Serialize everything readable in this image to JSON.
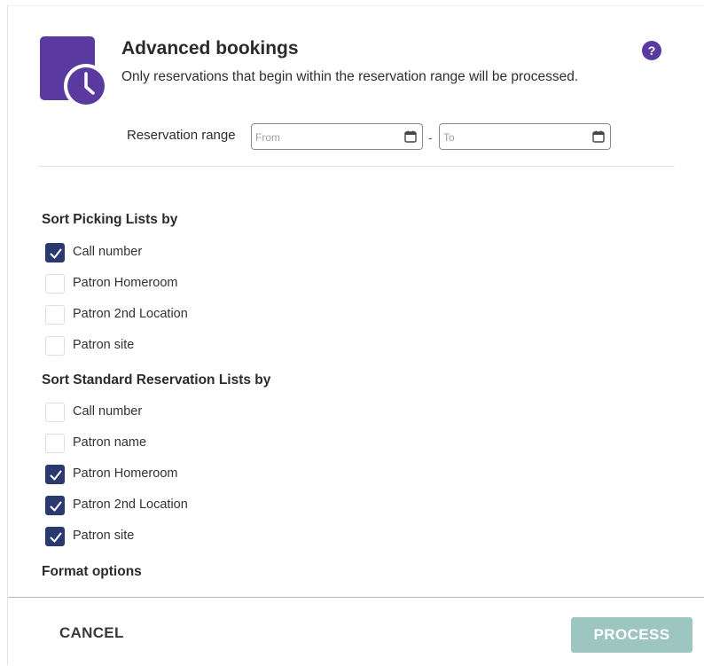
{
  "dialog": {
    "title": "Advanced bookings",
    "subtitle": "Only reservations that begin within the reservation range will be processed.",
    "icon": "calendar-clock-icon",
    "help_icon": "question-mark-icon",
    "help_label": "?"
  },
  "reservation_range": {
    "label": "Reservation range",
    "from": {
      "value": "",
      "placeholder": "From"
    },
    "separator": "-",
    "to": {
      "value": "",
      "placeholder": "To"
    }
  },
  "sections": {
    "picking": {
      "title": "Sort Picking Lists by",
      "options": [
        {
          "label": "Call number",
          "checked": true
        },
        {
          "label": "Patron Homeroom",
          "checked": false
        },
        {
          "label": "Patron 2nd Location",
          "checked": false
        },
        {
          "label": "Patron site",
          "checked": false
        }
      ]
    },
    "standard": {
      "title": "Sort Standard Reservation Lists by",
      "options": [
        {
          "label": "Call number",
          "checked": false
        },
        {
          "label": "Patron name",
          "checked": false
        },
        {
          "label": "Patron Homeroom",
          "checked": true
        },
        {
          "label": "Patron 2nd Location",
          "checked": true
        },
        {
          "label": "Patron site",
          "checked": true
        }
      ]
    },
    "format": {
      "title": "Format options"
    }
  },
  "footer": {
    "cancel_label": "CANCEL",
    "process_label": "PROCESS"
  },
  "colors": {
    "accent_purple": "#5a3a9e",
    "checkbox_checked": "#2a3a6e",
    "process_disabled": "#9ec6c0"
  }
}
